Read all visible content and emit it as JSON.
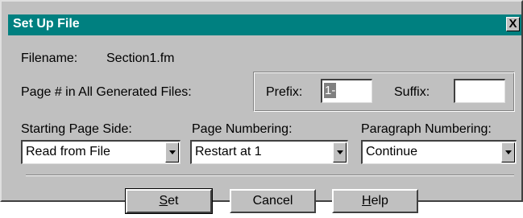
{
  "window": {
    "title": "Set Up File",
    "close_glyph": "X"
  },
  "file": {
    "filename_label": "Filename:",
    "filename_value": "Section1.fm"
  },
  "page_number": {
    "label": "Page # in All Generated Files:",
    "prefix_label": "Prefix:",
    "prefix_value": "1-",
    "suffix_label": "Suffix:",
    "suffix_value": ""
  },
  "starting_page_side": {
    "label": "Starting Page Side:",
    "selected": "Read from File"
  },
  "page_numbering": {
    "label": "Page Numbering:",
    "selected": "Restart at 1"
  },
  "paragraph_numbering": {
    "label": "Paragraph Numbering:",
    "selected": "Continue"
  },
  "buttons": {
    "set_mnemonic": "S",
    "set_rest": "et",
    "cancel": "Cancel",
    "help_mnemonic": "H",
    "help_rest": "elp"
  },
  "colors": {
    "titlebar": "#008080",
    "dialog_face": "#c0c0c0"
  },
  "icons": {
    "close": "close-icon",
    "dropdown": "chevron-down-icon"
  }
}
